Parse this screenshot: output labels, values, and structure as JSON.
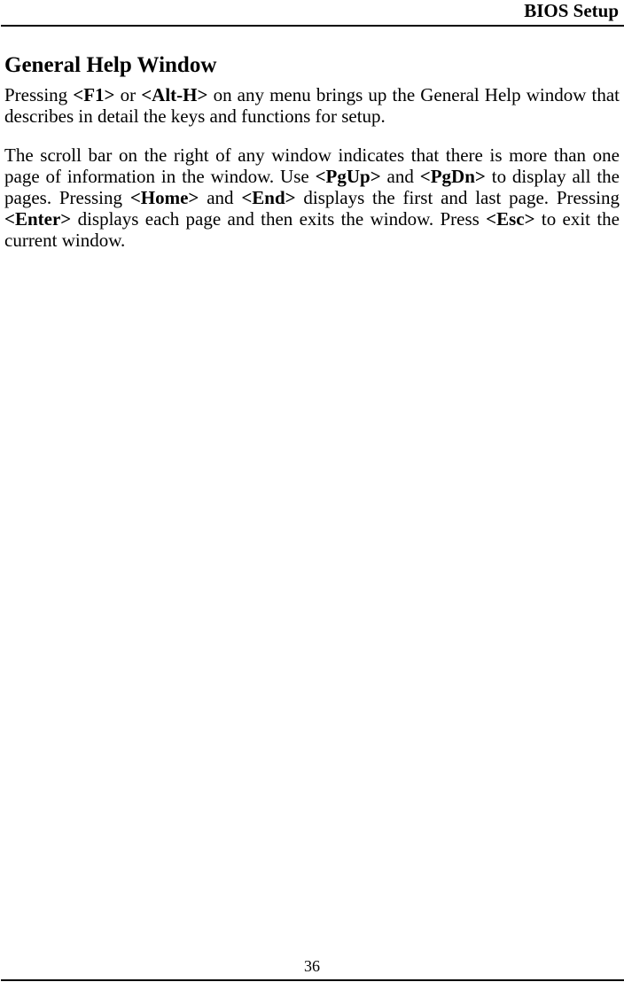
{
  "header": {
    "title": "BIOS Setup"
  },
  "section": {
    "title": "General Help Window"
  },
  "paragraphs": [
    {
      "segments": [
        {
          "text": "Pressing ",
          "bold": false
        },
        {
          "text": "<F1>",
          "bold": true
        },
        {
          "text": " or ",
          "bold": false
        },
        {
          "text": "<Alt-H>",
          "bold": true
        },
        {
          "text": " on any menu brings up the General Help window that describes in detail the keys and functions for setup.",
          "bold": false
        }
      ]
    },
    {
      "segments": [
        {
          "text": "The scroll bar on the right of any window indicates that there is more than one page of information in the window. Use ",
          "bold": false
        },
        {
          "text": "<PgUp>",
          "bold": true
        },
        {
          "text": " and ",
          "bold": false
        },
        {
          "text": "<PgDn>",
          "bold": true
        },
        {
          "text": " to display all the pages. Pressing ",
          "bold": false
        },
        {
          "text": "<Home>",
          "bold": true
        },
        {
          "text": " and ",
          "bold": false
        },
        {
          "text": "<End>",
          "bold": true
        },
        {
          "text": " displays the first and last page. Pressing ",
          "bold": false
        },
        {
          "text": "<Enter>",
          "bold": true
        },
        {
          "text": " displays each page and then exits the window. Press ",
          "bold": false
        },
        {
          "text": "<Esc>",
          "bold": true
        },
        {
          "text": " to exit the current window.",
          "bold": false
        }
      ]
    }
  ],
  "footer": {
    "page_number": "36"
  }
}
